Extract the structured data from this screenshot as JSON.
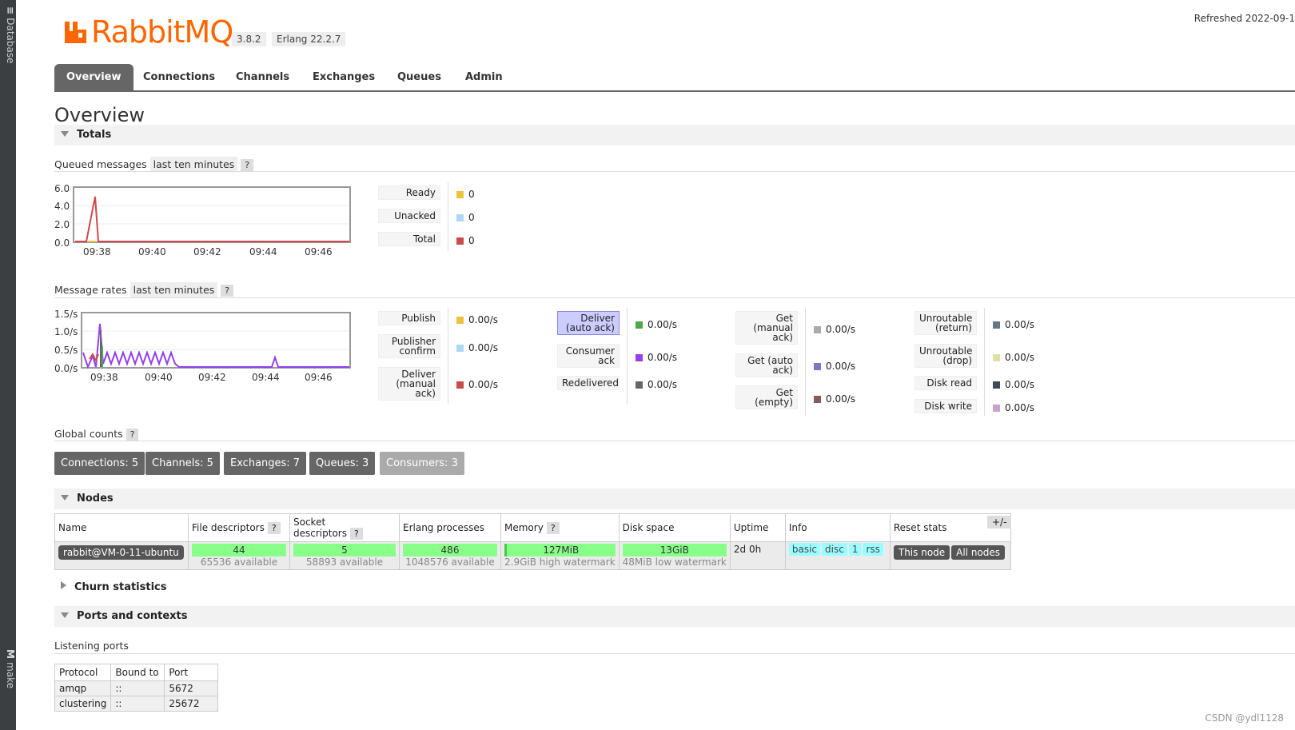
{
  "sidebar": {
    "top_label": "Database",
    "bottom_label": "make"
  },
  "header": {
    "logo_text": "RabbitMQ",
    "version": "3.8.2",
    "erlang": "Erlang 22.2.7",
    "refreshed": "Refreshed 2022-09-1"
  },
  "tabs": [
    "Overview",
    "Connections",
    "Channels",
    "Exchanges",
    "Queues",
    "Admin"
  ],
  "page_title": "Overview",
  "totals": {
    "heading": "Totals",
    "queued_label": "Queued messages",
    "queued_range": "last ten minutes",
    "help": "?",
    "queued_chart": {
      "yticks": [
        "6.0",
        "4.0",
        "2.0",
        "0.0"
      ],
      "xticks": [
        "09:38",
        "09:40",
        "09:42",
        "09:44",
        "09:46"
      ]
    },
    "queued_legend": [
      {
        "label": "Ready",
        "value": "0",
        "color": "#edc240"
      },
      {
        "label": "Unacked",
        "value": "0",
        "color": "#afd8f8"
      },
      {
        "label": "Total",
        "value": "0",
        "color": "#cb4b4b"
      }
    ],
    "rates_label": "Message rates",
    "rates_range": "last ten minutes",
    "rates_chart": {
      "yticks": [
        "1.5/s",
        "1.0/s",
        "0.5/s",
        "0.0/s"
      ],
      "xticks": [
        "09:38",
        "09:40",
        "09:42",
        "09:44",
        "09:46"
      ]
    },
    "rates_legend": [
      {
        "label": "Publish",
        "value": "0.00/s",
        "color": "#edc240"
      },
      {
        "label": "Publisher confirm",
        "value": "0.00/s",
        "color": "#afd8f8"
      },
      {
        "label": "Deliver (manual ack)",
        "value": "0.00/s",
        "color": "#cb4b4b"
      },
      {
        "label": "Deliver (auto ack)",
        "value": "0.00/s",
        "color": "#4da74d"
      },
      {
        "label": "Consumer ack",
        "value": "0.00/s",
        "color": "#9440ed"
      },
      {
        "label": "Redelivered",
        "value": "0.00/s",
        "color": "#666666"
      },
      {
        "label": "Get (manual ack)",
        "value": "0.00/s",
        "color": "#aaaaaa"
      },
      {
        "label": "Get (auto ack)",
        "value": "0.00/s",
        "color": "#7c79c3"
      },
      {
        "label": "Get (empty)",
        "value": "0.00/s",
        "color": "#8b5a5a"
      },
      {
        "label": "Unroutable (return)",
        "value": "0.00/s",
        "color": "#667788"
      },
      {
        "label": "Unroutable (drop)",
        "value": "0.00/s",
        "color": "#e0e0a8"
      },
      {
        "label": "Disk read",
        "value": "0.00/s",
        "color": "#434a57"
      },
      {
        "label": "Disk write",
        "value": "0.00/s",
        "color": "#c7a5c9"
      }
    ],
    "global_label": "Global counts",
    "global_counts": [
      "Connections: 5",
      "Channels: 5",
      "Exchanges: 7",
      "Queues: 3",
      "Consumers: 3"
    ]
  },
  "nodes": {
    "heading": "Nodes",
    "columns": [
      "Name",
      "File descriptors",
      "Socket descriptors",
      "Erlang processes",
      "Memory",
      "Disk space",
      "Uptime",
      "Info",
      "Reset stats"
    ],
    "plus_minus": "+/-",
    "row": {
      "name": "rabbit@VM-0-11-ubuntu",
      "fd": "44",
      "fd_sub": "65536 available",
      "sd": "5",
      "sd_sub": "58893 available",
      "ep": "486",
      "ep_sub": "1048576 available",
      "mem": "127MiB",
      "mem_sub": "2.9GiB high watermark",
      "disk": "13GiB",
      "disk_sub": "48MiB low watermark",
      "uptime": "2d 0h",
      "info": [
        "basic",
        "disc",
        "1",
        "rss"
      ],
      "reset": [
        "This node",
        "All nodes"
      ]
    }
  },
  "churn": {
    "heading": "Churn statistics"
  },
  "ports": {
    "heading": "Ports and contexts",
    "listening_label": "Listening ports",
    "columns": [
      "Protocol",
      "Bound to",
      "Port"
    ],
    "rows": [
      [
        "amqp",
        "::",
        "5672"
      ],
      [
        "clustering",
        "::",
        "25672"
      ]
    ]
  },
  "watermark": "CSDN @ydl1128"
}
